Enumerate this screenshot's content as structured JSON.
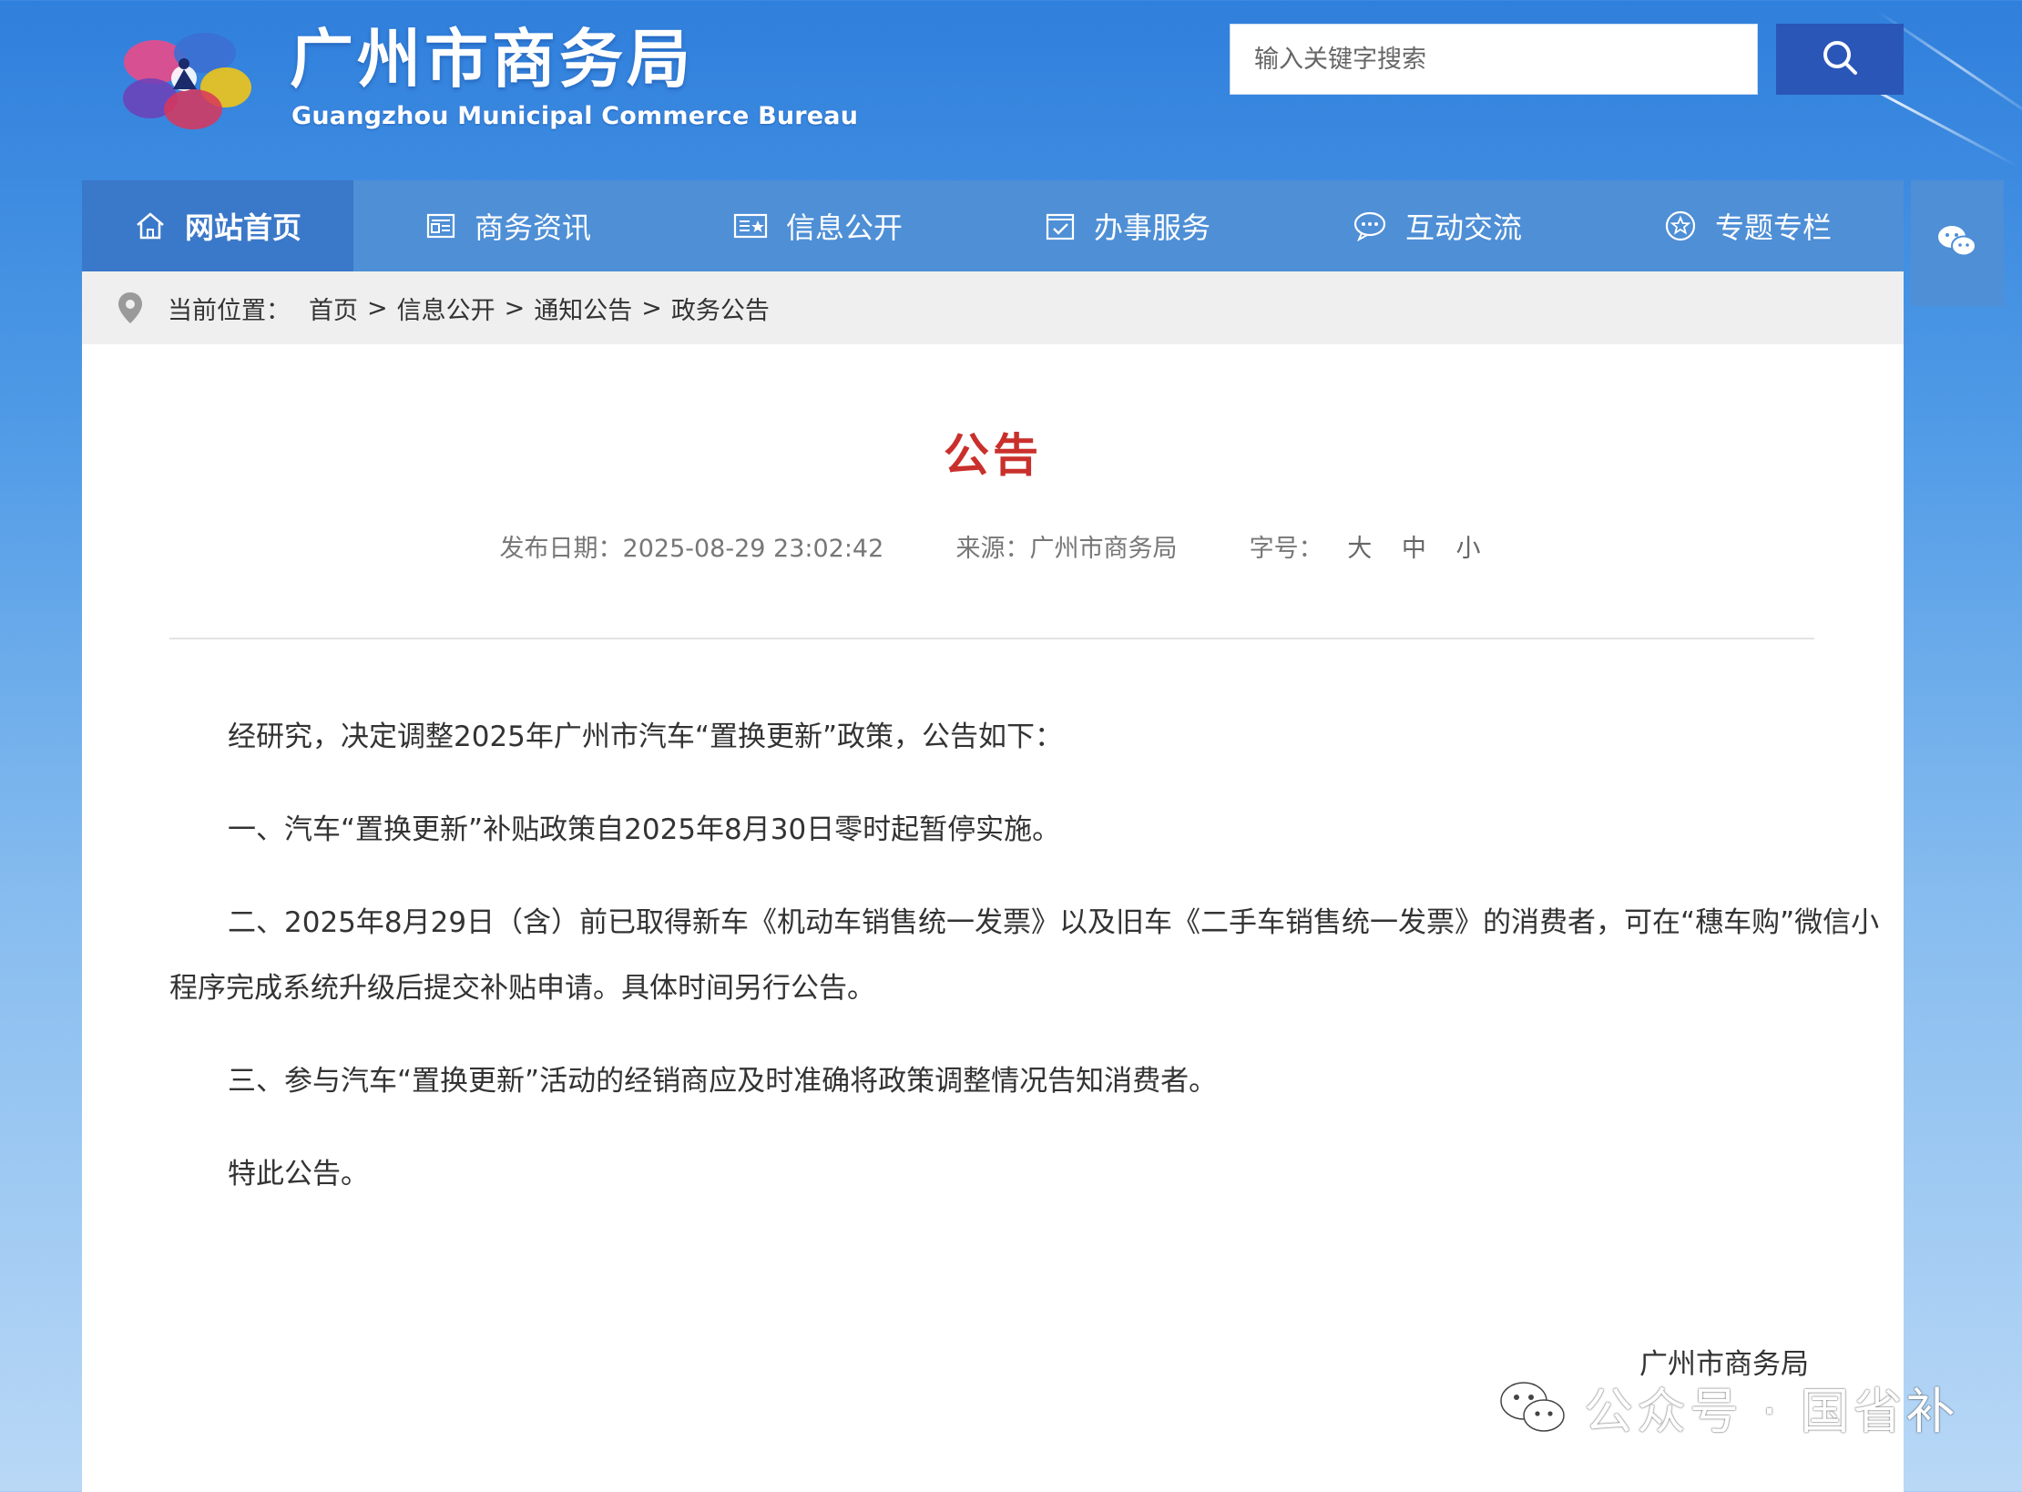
{
  "header": {
    "title": "广州市商务局",
    "subtitle": "Guangzhou Municipal Commerce Bureau",
    "search": {
      "placeholder": "输入关键字搜索",
      "value": ""
    }
  },
  "nav": {
    "items": [
      {
        "label": "网站首页",
        "icon": "home-icon",
        "active": true
      },
      {
        "label": "商务资讯",
        "icon": "news-icon",
        "active": false
      },
      {
        "label": "信息公开",
        "icon": "info-card-icon",
        "active": false
      },
      {
        "label": "办事服务",
        "icon": "check-box-icon",
        "active": false
      },
      {
        "label": "互动交流",
        "icon": "chat-bubble-icon",
        "active": false
      },
      {
        "label": "专题专栏",
        "icon": "star-circle-icon",
        "active": false
      }
    ]
  },
  "breadcrumb": {
    "prefix": "当前位置：",
    "items": [
      "首页",
      "信息公开",
      "通知公告",
      "政务公告"
    ],
    "separator": ">"
  },
  "article": {
    "title": "公告",
    "date_label": "发布日期：2025-08-29 23:02:42",
    "source_label": "来源：广州市商务局",
    "fontsize_label": "字号：",
    "fontsize_options": [
      "大",
      "中",
      "小"
    ],
    "paragraphs": [
      "经研究，决定调整2025年广州市汽车“置换更新”政策，公告如下：",
      "一、汽车“置换更新”补贴政策自2025年8月30日零时起暂停实施。",
      "二、2025年8月29日（含）前已取得新车《机动车销售统一发票》以及旧车《二手车销售统一发票》的消费者，可在“穗车购”微信小程序完成系统升级后提交补贴申请。具体时间另行公告。",
      "三、参与汽车“置换更新”活动的经销商应及时准确将政策调整情况告知消费者。",
      "特此公告。"
    ],
    "signature": "广州市商务局"
  },
  "watermark": {
    "text": "公众号 · 国省补"
  },
  "colors": {
    "nav_bg": "#4e8fd6",
    "nav_active": "#3a78c9",
    "search_button": "#2a56b8",
    "title_red": "#c9302c"
  }
}
